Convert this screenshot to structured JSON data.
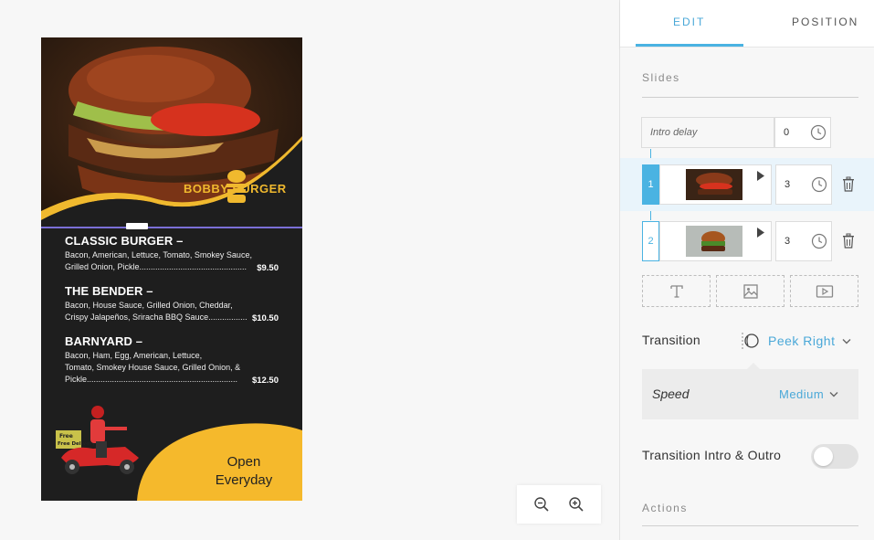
{
  "tabs": {
    "edit": "EDIT",
    "position": "POSITION",
    "active": "edit"
  },
  "preview": {
    "brand": "BOBBY BURGER",
    "menu": [
      {
        "title": "CLASSIC BURGER –",
        "desc_lines": [
          "Bacon, American, Lettuce, Tomato, Smokey Sauce,",
          "Grilled Onion, Pickle..............................................."
        ],
        "price": "$9.50"
      },
      {
        "title": "THE BENDER –",
        "desc_lines": [
          "Bacon, House Sauce, Grilled Onion, Cheddar,",
          "Crispy Jalapeños, Sriracha BBQ Sauce......................."
        ],
        "price": "$10.50"
      },
      {
        "title": "BARNYARD –",
        "desc_lines": [
          "Bacon, Ham, Egg, American, Lettuce,",
          "Tomato, Smokey House Sauce, Grilled Onion, &",
          "Pickle.................................................................."
        ],
        "price": "$12.50"
      }
    ],
    "delivery_badge": "Free Delivery!",
    "open_line1": "Open",
    "open_line2": "Everyday"
  },
  "zoom": {
    "zoom_out_icon": "zoom-out-icon",
    "zoom_in_icon": "zoom-in-icon"
  },
  "slides": {
    "section_label": "Slides",
    "intro_delay_label": "Intro delay",
    "intro_delay_value": "0",
    "items": [
      {
        "number": "1",
        "duration": "3",
        "active": true
      },
      {
        "number": "2",
        "duration": "3",
        "active": false
      }
    ],
    "add_buttons": [
      "text-icon",
      "image-icon",
      "video-icon"
    ]
  },
  "transition": {
    "label": "Transition",
    "value": "Peek Right"
  },
  "speed": {
    "label": "Speed",
    "value": "Medium"
  },
  "transition_intro_outro": {
    "label": "Transition Intro & Outro",
    "enabled": false
  },
  "actions": {
    "section_label": "Actions"
  },
  "colors": {
    "accent": "#4ab3e2",
    "brand_yellow": "#f0b92e",
    "dark": "#1e1e1e"
  }
}
